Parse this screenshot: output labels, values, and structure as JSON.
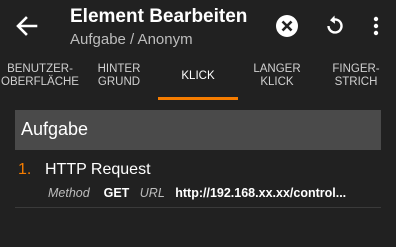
{
  "header": {
    "title": "Element Bearbeiten",
    "subtitle": "Aufgabe / Anonym",
    "icons": [
      "back-arrow-icon",
      "close-circle-icon",
      "refresh-icon",
      "more-vert-icon"
    ]
  },
  "tabs": [
    {
      "label": "BENUTZER-\nOBERFLÄCHE",
      "active": false
    },
    {
      "label": "HINTER\nGRUND",
      "active": false
    },
    {
      "label": "KLICK",
      "active": true
    },
    {
      "label": "LANGER\nKLICK",
      "active": false
    },
    {
      "label": "FINGER-\nSTRICH",
      "active": false
    }
  ],
  "section": {
    "title": "Aufgabe"
  },
  "actions": [
    {
      "number": "1.",
      "name": "HTTP Request",
      "method_label": "Method",
      "method_value": "GET",
      "url_label": "URL",
      "url_value": "http://192.168.xx.xx/control..."
    }
  ],
  "colors": {
    "accent": "#f57c00",
    "background": "#212121",
    "section_header": "#4a4a4a"
  }
}
